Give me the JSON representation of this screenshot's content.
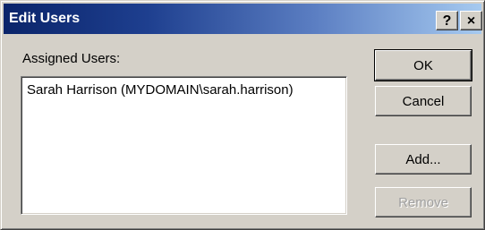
{
  "dialog": {
    "title": "Edit Users",
    "help_glyph": "?",
    "close_glyph": "×"
  },
  "assigned_users": {
    "label": "Assigned Users:",
    "items": [
      "Sarah Harrison (MYDOMAIN\\sarah.harrison)"
    ]
  },
  "buttons": {
    "ok": "OK",
    "cancel": "Cancel",
    "add": "Add...",
    "remove": "Remove"
  },
  "states": {
    "remove_enabled": false
  },
  "colors": {
    "face": "#d4d0c8",
    "title_start": "#0a246a",
    "title_end": "#a6caf0",
    "disabled_text": "#a0a0a0"
  }
}
